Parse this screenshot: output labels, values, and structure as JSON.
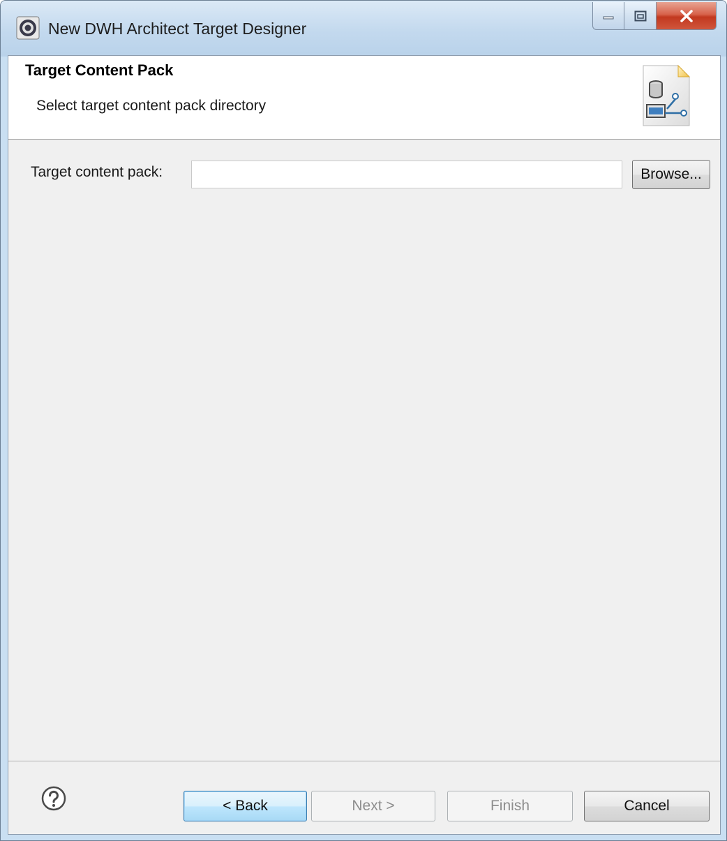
{
  "window": {
    "title": "New DWH Architect Target Designer"
  },
  "page": {
    "heading": "Target Content Pack",
    "description": "Select target content pack directory"
  },
  "form": {
    "target_label": "Target content pack:",
    "target_value": "",
    "browse_label": "Browse..."
  },
  "footer": {
    "back_label": "< Back",
    "next_label": "Next >",
    "finish_label": "Finish",
    "cancel_label": "Cancel"
  },
  "icons": {
    "app": "eclipse-app-icon",
    "wizard": "content-pack-wizard-icon",
    "help": "help-icon"
  },
  "colors": {
    "default_button_border": "#3c7fb1",
    "close_button": "#c2381f"
  }
}
